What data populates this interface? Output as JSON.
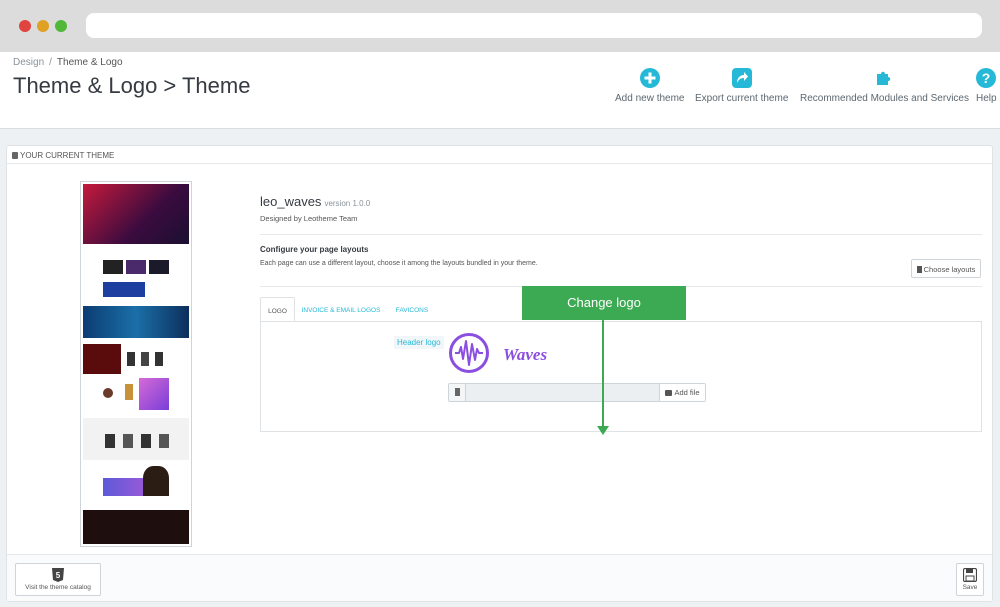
{
  "breadcrumb": {
    "parent": "Design",
    "separator": "/",
    "current": "Theme & Logo"
  },
  "page_title": "Theme & Logo > Theme",
  "toolbar": {
    "add_new_theme": "Add new theme",
    "export_current_theme": "Export current theme",
    "recommended_modules": "Recommended Modules and Services",
    "help": "Help"
  },
  "panel": {
    "heading": "YOUR CURRENT THEME"
  },
  "theme": {
    "name": "leo_waves",
    "version": "version 1.0.0",
    "designed_by": "Designed by Leotheme Team"
  },
  "layouts": {
    "title": "Configure your page layouts",
    "description": "Each page can use a different layout, choose it among the layouts bundled in your theme.",
    "choose_button": "Choose layouts"
  },
  "tabs": [
    {
      "label": "LOGO",
      "active": true
    },
    {
      "label": "INVOICE & EMAIL LOGOS",
      "active": false
    },
    {
      "label": "FAVICONS",
      "active": false
    }
  ],
  "logo_tab": {
    "header_logo_label": "Header logo",
    "logo_text": "Waves",
    "add_file": "Add file"
  },
  "callout": {
    "text": "Change logo"
  },
  "footer": {
    "catalog_button": "Visit the theme catalog",
    "save_button": "Save"
  },
  "colors": {
    "accent": "#25b9d7",
    "callout": "#3caa53",
    "logo_purple": "#8a4ee0"
  }
}
